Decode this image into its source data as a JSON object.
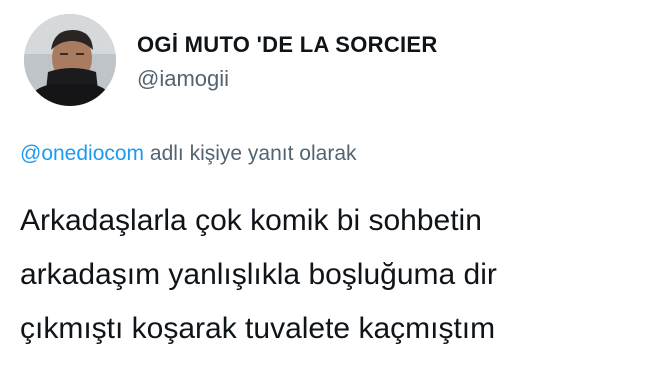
{
  "author": {
    "display_name": "OGİ MUTO 'DE LA SORCIER",
    "handle": "@iamogii"
  },
  "reply_context": {
    "mention": "@onediocom",
    "suffix": " adlı kişiye yanıt olarak"
  },
  "tweet": {
    "lines": [
      "Arkadaşlarla çok komik bi sohbetin",
      "arkadaşım yanlışlıkla boşluğuma dir",
      "çıkmıştı koşarak tuvalete kaçmıştım"
    ]
  },
  "colors": {
    "link": "#1d9bf0",
    "secondary_text": "#536471",
    "primary_text": "#0f1419"
  }
}
